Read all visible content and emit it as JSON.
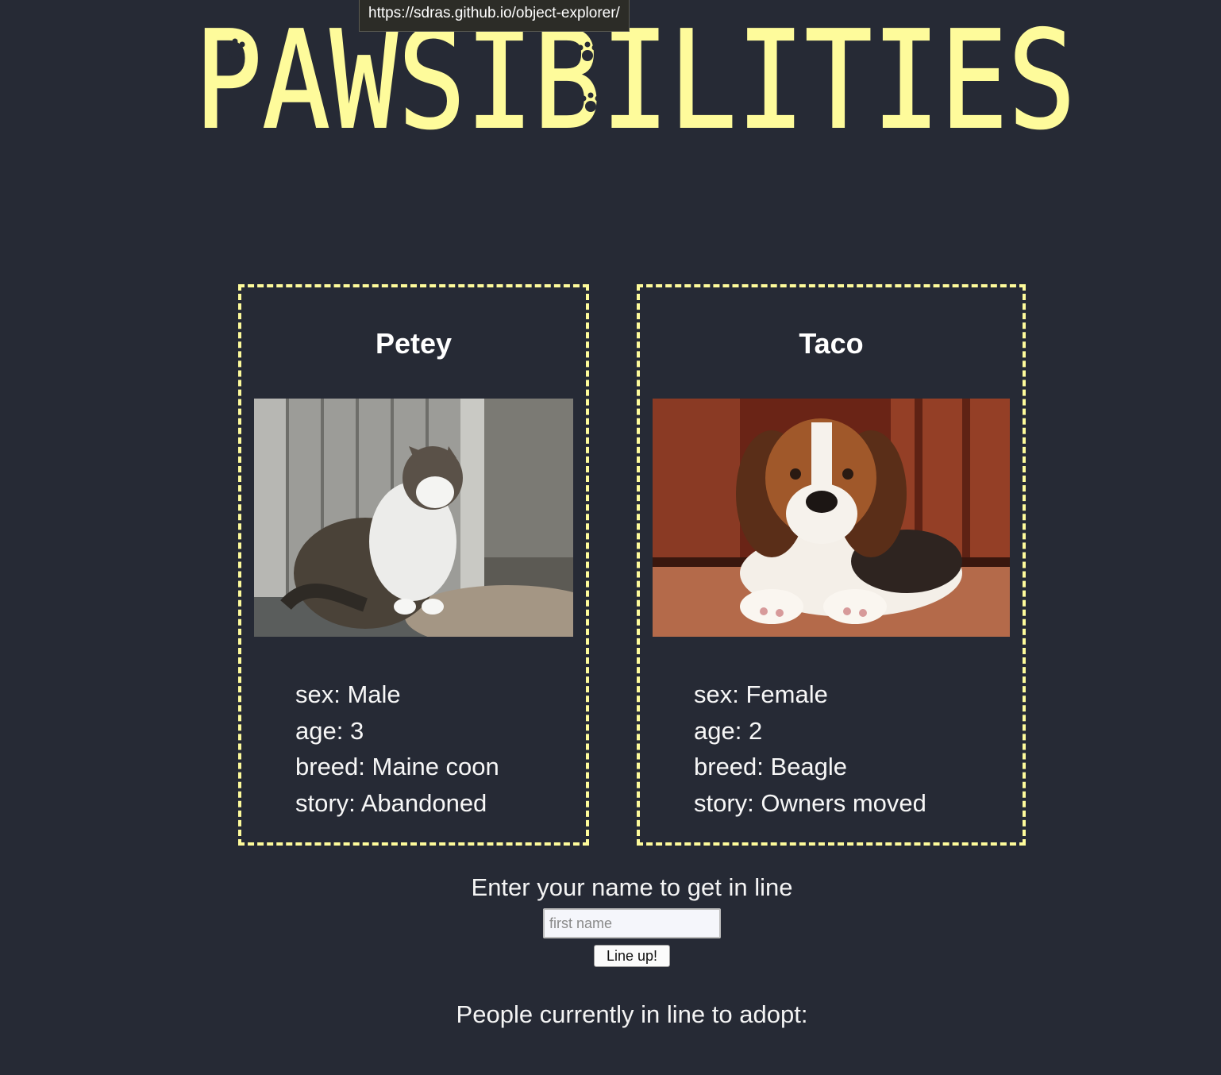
{
  "tooltip": {
    "url": "https://sdras.github.io/object-explorer/"
  },
  "header": {
    "title": "PAWSIBILITIES",
    "title_color": "#fefb9b"
  },
  "pets": [
    {
      "name": "Petey",
      "photo_icon": "cat-photo",
      "sex": "sex: Male",
      "age": "age: 3",
      "breed": "breed: Maine coon",
      "story": "story: Abandoned"
    },
    {
      "name": "Taco",
      "photo_icon": "dog-photo",
      "sex": "sex: Female",
      "age": "age: 2",
      "breed": "breed: Beagle",
      "story": "story: Owners moved"
    }
  ],
  "queue": {
    "label": "Enter your name to get in line",
    "input_placeholder": "first name",
    "button_label": "Line up!",
    "people_label": "People currently in line to adopt:"
  },
  "colors": {
    "background": "#262a35",
    "accent": "#fefb9b",
    "text": "#f4f4f4"
  }
}
